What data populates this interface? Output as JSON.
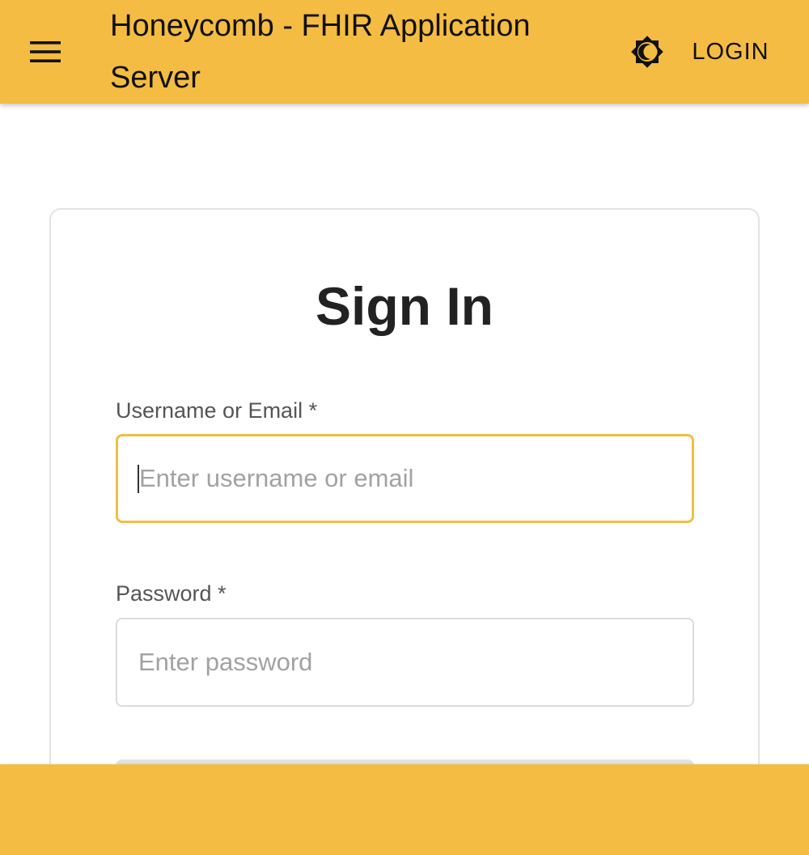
{
  "app_bar": {
    "title": "Honeycomb - FHIR Application Server",
    "menu_icon": "hamburger-menu-icon",
    "theme_icon": "brightness-icon",
    "login_label": "LOGIN"
  },
  "sign_in": {
    "title": "Sign In",
    "username_label": "Username or Email *",
    "username_placeholder": "Enter username or email",
    "username_value": "",
    "password_label": "Password *",
    "password_placeholder": "Enter password",
    "password_value": ""
  },
  "colors": {
    "accent": "#F4BC42",
    "focus_border": "#F0BE45"
  }
}
